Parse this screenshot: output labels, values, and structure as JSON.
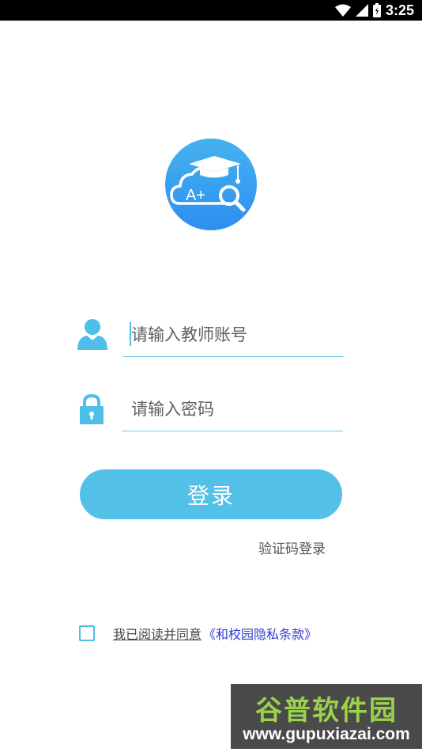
{
  "status_bar": {
    "time": "3:25"
  },
  "login": {
    "account_placeholder": "请输入教师账号",
    "password_placeholder": "请输入密码",
    "login_button": "登录",
    "sms_login": "验证码登录"
  },
  "agreement": {
    "text": "我已阅读并同意",
    "policy": "《和校园隐私条款》",
    "checked": false
  },
  "watermark": {
    "title": "谷普软件园",
    "url": "www.gupuxiazai.com"
  },
  "logo": {
    "badge_text": "A+"
  },
  "colors": {
    "accent": "#53c0e8",
    "logo_gradient_top": "#45b2ef",
    "logo_gradient_bottom": "#2d8ff0",
    "link": "#2f3bd6",
    "status_bar": "#000000"
  },
  "icons": [
    "wifi-icon",
    "signal-icon",
    "battery-icon",
    "user-icon",
    "lock-icon",
    "graduation-cap-icon",
    "magnifier-icon"
  ]
}
